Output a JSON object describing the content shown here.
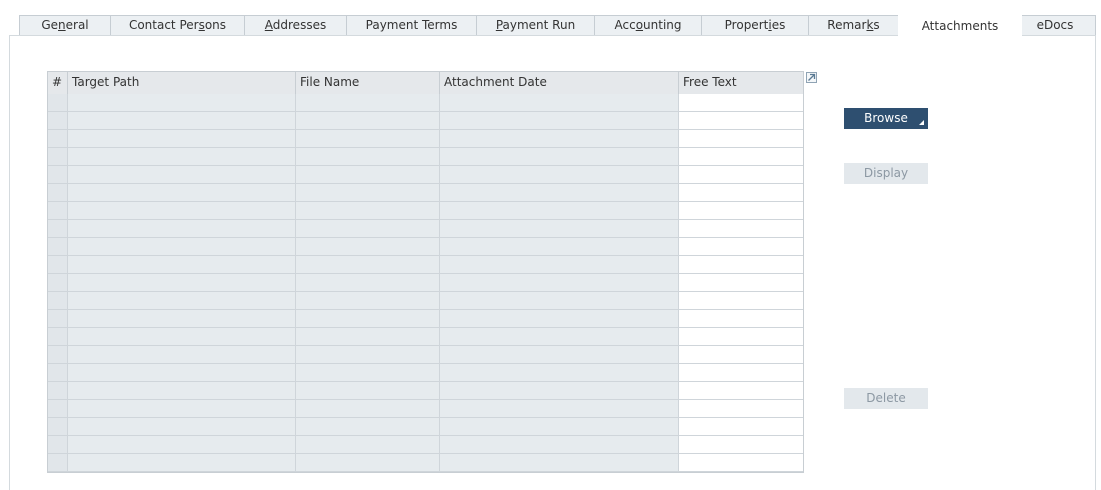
{
  "tabs": [
    {
      "id": "general",
      "label_pre": "Ge",
      "label_ul": "n",
      "label_post": "eral",
      "active": false
    },
    {
      "id": "contact-persons",
      "label_pre": "Contact Per",
      "label_ul": "s",
      "label_post": "ons",
      "active": false
    },
    {
      "id": "addresses",
      "label_pre": "",
      "label_ul": "A",
      "label_post": "ddresses",
      "active": false
    },
    {
      "id": "payment-terms",
      "label_pre": "Payment Terms",
      "label_ul": "",
      "label_post": "",
      "active": false
    },
    {
      "id": "payment-run",
      "label_pre": "",
      "label_ul": "P",
      "label_post": "ayment Run",
      "active": false
    },
    {
      "id": "accounting",
      "label_pre": "Acc",
      "label_ul": "o",
      "label_post": "unting",
      "active": false
    },
    {
      "id": "properties",
      "label_pre": "Propert",
      "label_ul": "i",
      "label_post": "es",
      "active": false
    },
    {
      "id": "remarks",
      "label_pre": "Remar",
      "label_ul": "k",
      "label_post": "s",
      "active": false
    },
    {
      "id": "attachments",
      "label_pre": "Attachments",
      "label_ul": "",
      "label_post": "",
      "active": true
    },
    {
      "id": "edocs",
      "label_pre": "eDocs",
      "label_ul": "",
      "label_post": "",
      "active": false
    }
  ],
  "grid": {
    "columns": [
      {
        "id": "num",
        "label": "#"
      },
      {
        "id": "target-path",
        "label": "Target Path"
      },
      {
        "id": "file-name",
        "label": "File Name"
      },
      {
        "id": "attachment-date",
        "label": "Attachment Date"
      },
      {
        "id": "free-text",
        "label": "Free Text"
      }
    ],
    "rows": [
      {
        "num": "",
        "target_path": "",
        "file_name": "",
        "attachment_date": "",
        "free_text": ""
      },
      {
        "num": "",
        "target_path": "",
        "file_name": "",
        "attachment_date": "",
        "free_text": ""
      },
      {
        "num": "",
        "target_path": "",
        "file_name": "",
        "attachment_date": "",
        "free_text": ""
      },
      {
        "num": "",
        "target_path": "",
        "file_name": "",
        "attachment_date": "",
        "free_text": ""
      },
      {
        "num": "",
        "target_path": "",
        "file_name": "",
        "attachment_date": "",
        "free_text": ""
      },
      {
        "num": "",
        "target_path": "",
        "file_name": "",
        "attachment_date": "",
        "free_text": ""
      },
      {
        "num": "",
        "target_path": "",
        "file_name": "",
        "attachment_date": "",
        "free_text": ""
      },
      {
        "num": "",
        "target_path": "",
        "file_name": "",
        "attachment_date": "",
        "free_text": ""
      },
      {
        "num": "",
        "target_path": "",
        "file_name": "",
        "attachment_date": "",
        "free_text": ""
      },
      {
        "num": "",
        "target_path": "",
        "file_name": "",
        "attachment_date": "",
        "free_text": ""
      },
      {
        "num": "",
        "target_path": "",
        "file_name": "",
        "attachment_date": "",
        "free_text": ""
      },
      {
        "num": "",
        "target_path": "",
        "file_name": "",
        "attachment_date": "",
        "free_text": ""
      },
      {
        "num": "",
        "target_path": "",
        "file_name": "",
        "attachment_date": "",
        "free_text": ""
      },
      {
        "num": "",
        "target_path": "",
        "file_name": "",
        "attachment_date": "",
        "free_text": ""
      },
      {
        "num": "",
        "target_path": "",
        "file_name": "",
        "attachment_date": "",
        "free_text": ""
      },
      {
        "num": "",
        "target_path": "",
        "file_name": "",
        "attachment_date": "",
        "free_text": ""
      },
      {
        "num": "",
        "target_path": "",
        "file_name": "",
        "attachment_date": "",
        "free_text": ""
      },
      {
        "num": "",
        "target_path": "",
        "file_name": "",
        "attachment_date": "",
        "free_text": ""
      },
      {
        "num": "",
        "target_path": "",
        "file_name": "",
        "attachment_date": "",
        "free_text": ""
      },
      {
        "num": "",
        "target_path": "",
        "file_name": "",
        "attachment_date": "",
        "free_text": ""
      },
      {
        "num": "",
        "target_path": "",
        "file_name": "",
        "attachment_date": "",
        "free_text": ""
      }
    ]
  },
  "buttons": {
    "browse": {
      "label": "Browse",
      "enabled": true
    },
    "display": {
      "label": "Display",
      "enabled": false
    },
    "delete": {
      "label": "Delete",
      "enabled": false
    }
  },
  "icons": {
    "expand": "expand-arrow-icon",
    "browse_menu": "dropdown-corner-icon"
  },
  "colors": {
    "primary_button": "#2e4f70",
    "grid_readonly": "#e6ebee",
    "grid_editable": "#ffffff"
  }
}
